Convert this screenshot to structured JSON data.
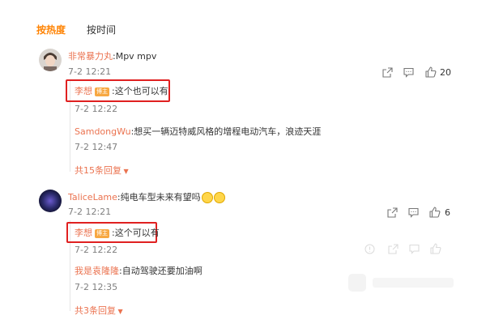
{
  "tabs": [
    {
      "label": "按热度"
    },
    {
      "label": "按时间"
    }
  ],
  "comments": [
    {
      "author": "非常暴力丸",
      "text": ":Mpv mpv",
      "time": "7-2 12:21",
      "likes": "20",
      "replies": [
        {
          "author": "李想",
          "badge": "博主",
          "text": ":这个也可以有",
          "time": "7-2 12:22"
        },
        {
          "author": "SamdongWu",
          "text": ":想买一辆迈特威风格的增程电动汽车，浪迹天涯",
          "time": "7-2 12:47"
        }
      ],
      "more": "共15条回复"
    },
    {
      "author": "TaliceLame",
      "text": ":纯电车型未来有望吗",
      "time": "7-2 12:21",
      "likes": "6",
      "replies": [
        {
          "author": "李想",
          "badge": "博主",
          "text": ":这个可以有",
          "time": "7-2 12:22"
        },
        {
          "author": "我是袁隆隆",
          "text": ":自动驾驶还要加油啊",
          "time": "7-2 12:35"
        }
      ],
      "more": "共3条回复"
    }
  ],
  "colors": {
    "accent": "#ff8200",
    "name": "#eb7350",
    "highlight_box": "#e02020"
  }
}
